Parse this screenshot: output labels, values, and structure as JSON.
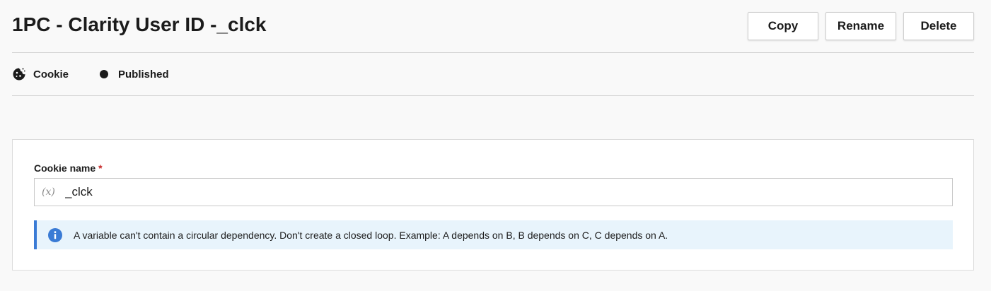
{
  "header": {
    "title": "1PC - Clarity User ID -_clck",
    "actions": {
      "copy_label": "Copy",
      "rename_label": "Rename",
      "delete_label": "Delete"
    }
  },
  "meta": {
    "type_label": "Cookie",
    "type_icon": "cookie-icon",
    "status_label": "Published",
    "status_icon": "status-dot-icon"
  },
  "form": {
    "cookie_name": {
      "label": "Cookie name",
      "required_marker": "*",
      "variable_icon_text": "(x)",
      "value": "_clck"
    },
    "info": {
      "icon": "info-icon",
      "accent_color": "#3a7bd5",
      "background_color": "#e8f4fc",
      "text": "A variable can't contain a circular dependency. Don't create a closed loop. Example: A depends on B, B depends on C, C depends on A."
    }
  },
  "colors": {
    "required": "#c62828",
    "text": "#1b1b1b",
    "page_background": "#f9f9f9"
  }
}
